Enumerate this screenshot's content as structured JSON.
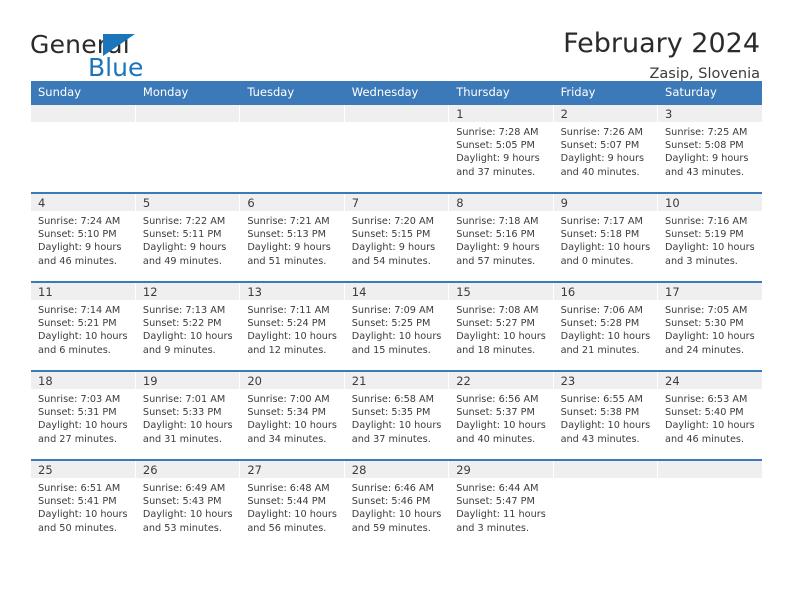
{
  "brand": {
    "word_general": "General",
    "word_blue": "Blue",
    "flag_icon": "flag-triangle-icon",
    "accent_color": "#1b75bb"
  },
  "header": {
    "title": "February 2024",
    "subtitle": "Zasip, Slovenia"
  },
  "theme": {
    "header_blue": "#3b79b8",
    "daynum_band": "#efefef",
    "text": "#3c3c3c"
  },
  "calendar": {
    "weekday_headers": [
      "Sunday",
      "Monday",
      "Tuesday",
      "Wednesday",
      "Thursday",
      "Friday",
      "Saturday"
    ],
    "labels": {
      "sunrise_prefix": "Sunrise:",
      "sunset_prefix": "Sunset:",
      "daylight_prefix": "Daylight:"
    },
    "weeks": [
      [
        {
          "day": "",
          "empty": true
        },
        {
          "day": "",
          "empty": true
        },
        {
          "day": "",
          "empty": true
        },
        {
          "day": "",
          "empty": true
        },
        {
          "day": "1",
          "sunrise": "Sunrise: 7:28 AM",
          "sunset": "Sunset: 5:05 PM",
          "daylight_line1": "Daylight: 9 hours",
          "daylight_line2": "and 37 minutes."
        },
        {
          "day": "2",
          "sunrise": "Sunrise: 7:26 AM",
          "sunset": "Sunset: 5:07 PM",
          "daylight_line1": "Daylight: 9 hours",
          "daylight_line2": "and 40 minutes."
        },
        {
          "day": "3",
          "sunrise": "Sunrise: 7:25 AM",
          "sunset": "Sunset: 5:08 PM",
          "daylight_line1": "Daylight: 9 hours",
          "daylight_line2": "and 43 minutes."
        }
      ],
      [
        {
          "day": "4",
          "sunrise": "Sunrise: 7:24 AM",
          "sunset": "Sunset: 5:10 PM",
          "daylight_line1": "Daylight: 9 hours",
          "daylight_line2": "and 46 minutes."
        },
        {
          "day": "5",
          "sunrise": "Sunrise: 7:22 AM",
          "sunset": "Sunset: 5:11 PM",
          "daylight_line1": "Daylight: 9 hours",
          "daylight_line2": "and 49 minutes."
        },
        {
          "day": "6",
          "sunrise": "Sunrise: 7:21 AM",
          "sunset": "Sunset: 5:13 PM",
          "daylight_line1": "Daylight: 9 hours",
          "daylight_line2": "and 51 minutes."
        },
        {
          "day": "7",
          "sunrise": "Sunrise: 7:20 AM",
          "sunset": "Sunset: 5:15 PM",
          "daylight_line1": "Daylight: 9 hours",
          "daylight_line2": "and 54 minutes."
        },
        {
          "day": "8",
          "sunrise": "Sunrise: 7:18 AM",
          "sunset": "Sunset: 5:16 PM",
          "daylight_line1": "Daylight: 9 hours",
          "daylight_line2": "and 57 minutes."
        },
        {
          "day": "9",
          "sunrise": "Sunrise: 7:17 AM",
          "sunset": "Sunset: 5:18 PM",
          "daylight_line1": "Daylight: 10 hours",
          "daylight_line2": "and 0 minutes."
        },
        {
          "day": "10",
          "sunrise": "Sunrise: 7:16 AM",
          "sunset": "Sunset: 5:19 PM",
          "daylight_line1": "Daylight: 10 hours",
          "daylight_line2": "and 3 minutes."
        }
      ],
      [
        {
          "day": "11",
          "sunrise": "Sunrise: 7:14 AM",
          "sunset": "Sunset: 5:21 PM",
          "daylight_line1": "Daylight: 10 hours",
          "daylight_line2": "and 6 minutes."
        },
        {
          "day": "12",
          "sunrise": "Sunrise: 7:13 AM",
          "sunset": "Sunset: 5:22 PM",
          "daylight_line1": "Daylight: 10 hours",
          "daylight_line2": "and 9 minutes."
        },
        {
          "day": "13",
          "sunrise": "Sunrise: 7:11 AM",
          "sunset": "Sunset: 5:24 PM",
          "daylight_line1": "Daylight: 10 hours",
          "daylight_line2": "and 12 minutes."
        },
        {
          "day": "14",
          "sunrise": "Sunrise: 7:09 AM",
          "sunset": "Sunset: 5:25 PM",
          "daylight_line1": "Daylight: 10 hours",
          "daylight_line2": "and 15 minutes."
        },
        {
          "day": "15",
          "sunrise": "Sunrise: 7:08 AM",
          "sunset": "Sunset: 5:27 PM",
          "daylight_line1": "Daylight: 10 hours",
          "daylight_line2": "and 18 minutes."
        },
        {
          "day": "16",
          "sunrise": "Sunrise: 7:06 AM",
          "sunset": "Sunset: 5:28 PM",
          "daylight_line1": "Daylight: 10 hours",
          "daylight_line2": "and 21 minutes."
        },
        {
          "day": "17",
          "sunrise": "Sunrise: 7:05 AM",
          "sunset": "Sunset: 5:30 PM",
          "daylight_line1": "Daylight: 10 hours",
          "daylight_line2": "and 24 minutes."
        }
      ],
      [
        {
          "day": "18",
          "sunrise": "Sunrise: 7:03 AM",
          "sunset": "Sunset: 5:31 PM",
          "daylight_line1": "Daylight: 10 hours",
          "daylight_line2": "and 27 minutes."
        },
        {
          "day": "19",
          "sunrise": "Sunrise: 7:01 AM",
          "sunset": "Sunset: 5:33 PM",
          "daylight_line1": "Daylight: 10 hours",
          "daylight_line2": "and 31 minutes."
        },
        {
          "day": "20",
          "sunrise": "Sunrise: 7:00 AM",
          "sunset": "Sunset: 5:34 PM",
          "daylight_line1": "Daylight: 10 hours",
          "daylight_line2": "and 34 minutes."
        },
        {
          "day": "21",
          "sunrise": "Sunrise: 6:58 AM",
          "sunset": "Sunset: 5:35 PM",
          "daylight_line1": "Daylight: 10 hours",
          "daylight_line2": "and 37 minutes."
        },
        {
          "day": "22",
          "sunrise": "Sunrise: 6:56 AM",
          "sunset": "Sunset: 5:37 PM",
          "daylight_line1": "Daylight: 10 hours",
          "daylight_line2": "and 40 minutes."
        },
        {
          "day": "23",
          "sunrise": "Sunrise: 6:55 AM",
          "sunset": "Sunset: 5:38 PM",
          "daylight_line1": "Daylight: 10 hours",
          "daylight_line2": "and 43 minutes."
        },
        {
          "day": "24",
          "sunrise": "Sunrise: 6:53 AM",
          "sunset": "Sunset: 5:40 PM",
          "daylight_line1": "Daylight: 10 hours",
          "daylight_line2": "and 46 minutes."
        }
      ],
      [
        {
          "day": "25",
          "sunrise": "Sunrise: 6:51 AM",
          "sunset": "Sunset: 5:41 PM",
          "daylight_line1": "Daylight: 10 hours",
          "daylight_line2": "and 50 minutes."
        },
        {
          "day": "26",
          "sunrise": "Sunrise: 6:49 AM",
          "sunset": "Sunset: 5:43 PM",
          "daylight_line1": "Daylight: 10 hours",
          "daylight_line2": "and 53 minutes."
        },
        {
          "day": "27",
          "sunrise": "Sunrise: 6:48 AM",
          "sunset": "Sunset: 5:44 PM",
          "daylight_line1": "Daylight: 10 hours",
          "daylight_line2": "and 56 minutes."
        },
        {
          "day": "28",
          "sunrise": "Sunrise: 6:46 AM",
          "sunset": "Sunset: 5:46 PM",
          "daylight_line1": "Daylight: 10 hours",
          "daylight_line2": "and 59 minutes."
        },
        {
          "day": "29",
          "sunrise": "Sunrise: 6:44 AM",
          "sunset": "Sunset: 5:47 PM",
          "daylight_line1": "Daylight: 11 hours",
          "daylight_line2": "and 3 minutes."
        },
        {
          "day": "",
          "empty": true
        },
        {
          "day": "",
          "empty": true
        }
      ]
    ]
  }
}
